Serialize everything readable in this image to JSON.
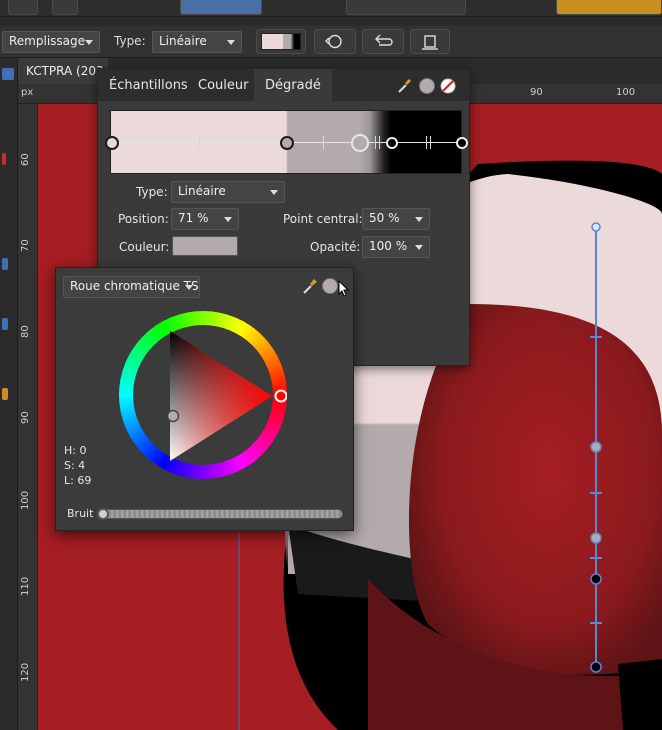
{
  "context_toolbar": {
    "fill_label": "Remplissage",
    "type_label": "Type:",
    "type_value": "Linéaire"
  },
  "document": {
    "tab_title": "KCTPRA (203"
  },
  "rulers": {
    "unit": "px",
    "top": [
      "90",
      "100"
    ],
    "left": [
      "60",
      "70",
      "80",
      "90",
      "100",
      "110",
      "120"
    ]
  },
  "gradient_panel": {
    "tabs": [
      "Échantillons",
      "Couleur",
      "Dégradé"
    ],
    "active_tab": "Dégradé",
    "type_label": "Type:",
    "type_value": "Linéaire",
    "position_label": "Position:",
    "position_value": "71 %",
    "midpoint_label": "Point central:",
    "midpoint_value": "50 %",
    "color_label": "Couleur:",
    "color_value": "#b3aaab",
    "opacity_label": "Opacité:",
    "opacity_value": "100 %",
    "stops": [
      {
        "position": 0.0,
        "color": "#ecd9da"
      },
      {
        "position": 0.5,
        "color": "#b3aaab"
      },
      {
        "position": 0.71,
        "color": "#b3aaab",
        "selected": true
      },
      {
        "position": 0.8,
        "color": "#000000"
      },
      {
        "position": 1.0,
        "color": "#000000"
      }
    ]
  },
  "color_popup": {
    "mode_value": "Roue chromatique TS",
    "h": "H: 0",
    "s": "S: 4",
    "l": "L: 69",
    "noise_label": "Bruit",
    "noise_value": 0
  },
  "colors": {
    "canvas_red": "#a51e22",
    "dark_red": "#5e1416",
    "light_pink": "#ecd9da",
    "grey_stop": "#b3aaab",
    "guide_blue": "#5a86d8"
  }
}
